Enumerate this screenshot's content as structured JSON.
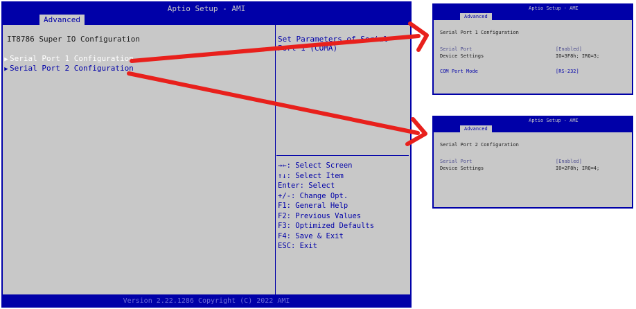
{
  "main": {
    "title": "Aptio Setup - AMI",
    "tab_label": "Advanced",
    "heading": "IT8786 Super IO Configuration",
    "menu_items": [
      {
        "label": "Serial Port 1 Configuration"
      },
      {
        "label": "Serial Port 2 Configuration"
      }
    ],
    "help_text": "Set Parameters of Serial Port 1 (COMA)",
    "keys": [
      "→←: Select Screen",
      "↑↓: Select Item",
      "Enter: Select",
      "+/-: Change Opt.",
      "F1: General Help",
      "F2: Previous Values",
      "F3: Optimized Defaults",
      "F4: Save & Exit",
      "ESC: Exit"
    ],
    "footer": "Version 2.22.1286 Copyright (C) 2022 AMI"
  },
  "inset1": {
    "title": "Aptio Setup - AMI",
    "tab_label": "Advanced",
    "heading": "Serial Port 1 Configuration",
    "rows": [
      {
        "label": "Serial Port",
        "value": "[Enabled]"
      },
      {
        "label": "Device Settings",
        "value": "IO=3F8h; IRQ=3;"
      },
      {
        "label": "COM Port Mode",
        "value": "[RS-232]"
      }
    ]
  },
  "inset2": {
    "title": "Aptio Setup - AMI",
    "tab_label": "Advanced",
    "heading": "Serial Port 2 Configuration",
    "rows": [
      {
        "label": "Serial Port",
        "value": "[Enabled]"
      },
      {
        "label": "Device Settings",
        "value": "IO=2F8h; IRQ=4;"
      }
    ]
  },
  "colors": {
    "bios_blue": "#0000a8",
    "panel_gray": "#c8c8c8",
    "annotation_red": "#e8201c"
  }
}
